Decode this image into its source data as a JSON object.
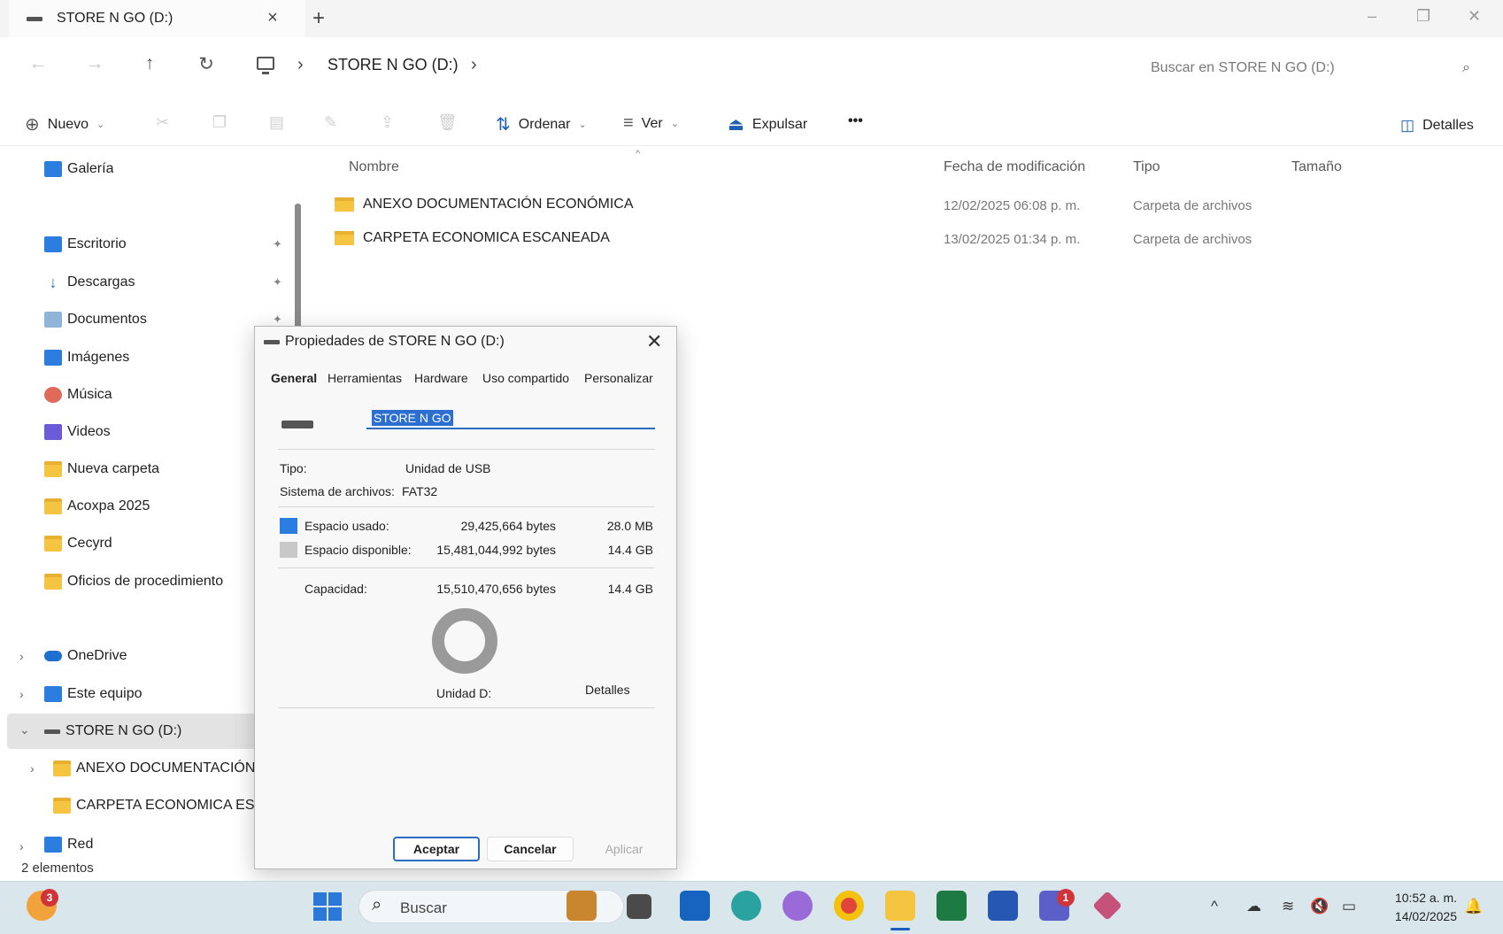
{
  "tab": {
    "title": "STORE N GO (D:)",
    "close_icon": "×",
    "new_icon": "+"
  },
  "window_controls": {
    "minimize": "–",
    "maximize": "❐",
    "close": "✕"
  },
  "nav": {
    "back": "←",
    "forward": "→",
    "up": "↑",
    "refresh": "↻"
  },
  "breadcrumb": {
    "current": "STORE N GO (D:)",
    "sep": "›"
  },
  "search": {
    "placeholder": "Buscar en STORE N GO (D:)",
    "icon": "⌕"
  },
  "toolbar": {
    "new_label": "Nuevo",
    "sort_label": "Ordenar",
    "view_label": "Ver",
    "eject_label": "Expulsar",
    "more_label": "•••",
    "details_label": "Detalles",
    "chevron": "⌄"
  },
  "sidebar": {
    "gallery": "Galería",
    "quick_access": [
      {
        "label": "Escritorio",
        "icon": "desktop-icon"
      },
      {
        "label": "Descargas",
        "icon": "download-icon"
      },
      {
        "label": "Documentos",
        "icon": "documents-icon"
      },
      {
        "label": "Imágenes",
        "icon": "pictures-icon"
      },
      {
        "label": "Música",
        "icon": "music-icon"
      },
      {
        "label": "Videos",
        "icon": "videos-icon"
      },
      {
        "label": "Nueva carpeta",
        "icon": "folder-icon"
      },
      {
        "label": "Acoxpa 2025",
        "icon": "folder-icon"
      },
      {
        "label": "Cecyrd",
        "icon": "folder-icon"
      },
      {
        "label": "Oficios de procedimiento",
        "icon": "folder-icon"
      }
    ],
    "onedrive": "OneDrive",
    "this_pc": "Este equipo",
    "drive": "STORE N GO (D:)",
    "drive_children": [
      "ANEXO DOCUMENTACIÓN E",
      "CARPETA ECONOMICA ESCA"
    ],
    "network": "Red",
    "pin_icon": "📌",
    "chev_right": "›",
    "chev_down": "⌄"
  },
  "columns": {
    "name": "Nombre",
    "modified": "Fecha de modificación",
    "type": "Tipo",
    "size": "Tamaño",
    "sort_icon": "^"
  },
  "files": [
    {
      "name": "ANEXO DOCUMENTACIÓN ECONÓMICA",
      "modified": "12/02/2025 06:08 p. m.",
      "type": "Carpeta de archivos"
    },
    {
      "name": "CARPETA ECONOMICA ESCANEADA",
      "modified": "13/02/2025 01:34 p. m.",
      "type": "Carpeta de archivos"
    }
  ],
  "status": "2 elementos",
  "dialog": {
    "title": "Propiedades de STORE N GO (D:)",
    "close": "✕",
    "tabs": [
      "General",
      "Herramientas",
      "Hardware",
      "Uso compartido",
      "Personalizar"
    ],
    "name_value": "STORE N GO",
    "type_label": "Tipo:",
    "type_value": "Unidad de USB",
    "fs_label": "Sistema de archivos:",
    "fs_value": "FAT32",
    "used_label": "Espacio usado:",
    "used_bytes": "29,425,664 bytes",
    "used_size": "28.0 MB",
    "free_label": "Espacio disponible:",
    "free_bytes": "15,481,044,992 bytes",
    "free_size": "14.4 GB",
    "capacity_label": "Capacidad:",
    "capacity_bytes": "15,510,470,656 bytes",
    "capacity_size": "14.4 GB",
    "drive_label": "Unidad D:",
    "details_button": "Detalles",
    "ok": "Aceptar",
    "cancel": "Cancelar",
    "apply": "Aplicar",
    "used_color": "#2b7de0",
    "free_color": "#c8c8c8"
  },
  "taskbar": {
    "search_label": "Buscar",
    "search_icon": "⌕",
    "weather_badge": "3",
    "teams_badge": "1",
    "time": "10:52 a. m.",
    "date": "14/02/2025",
    "tray_chevron": "^"
  }
}
